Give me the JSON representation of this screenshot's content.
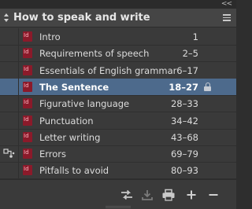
{
  "panel": {
    "collapse_glyph": "<<",
    "title": "How to speak and write"
  },
  "documents": [
    {
      "name": "Intro",
      "pages": "1",
      "selected": false,
      "locked": false,
      "sync": false
    },
    {
      "name": "Requirements of speech",
      "pages": "2–5",
      "selected": false,
      "locked": false,
      "sync": false
    },
    {
      "name": "Essentials of English grammar",
      "pages": "6–17",
      "selected": false,
      "locked": false,
      "sync": false
    },
    {
      "name": "The Sentence",
      "pages": "18–27",
      "selected": true,
      "locked": true,
      "sync": false
    },
    {
      "name": "Figurative language",
      "pages": "28–33",
      "selected": false,
      "locked": false,
      "sync": false
    },
    {
      "name": "Punctuation",
      "pages": "34–42",
      "selected": false,
      "locked": false,
      "sync": false
    },
    {
      "name": "Letter writing",
      "pages": "43–68",
      "selected": false,
      "locked": false,
      "sync": false
    },
    {
      "name": "Errors",
      "pages": "69–79",
      "selected": false,
      "locked": false,
      "sync": true
    },
    {
      "name": "Pitfalls to avoid",
      "pages": "80–93",
      "selected": false,
      "locked": false,
      "sync": false
    }
  ],
  "toolbar": {
    "buttons": [
      {
        "icon": "synchronize-styles-icon",
        "enabled": true
      },
      {
        "icon": "save-book-icon",
        "enabled": false
      },
      {
        "icon": "print-book-icon",
        "enabled": true
      },
      {
        "icon": "add-document-icon",
        "enabled": true
      },
      {
        "icon": "remove-document-icon",
        "enabled": true
      }
    ]
  },
  "colors": {
    "selection": "#4d6a8c",
    "doc_icon": "#8b1a2a",
    "panel_bg": "#3a3a3a"
  }
}
